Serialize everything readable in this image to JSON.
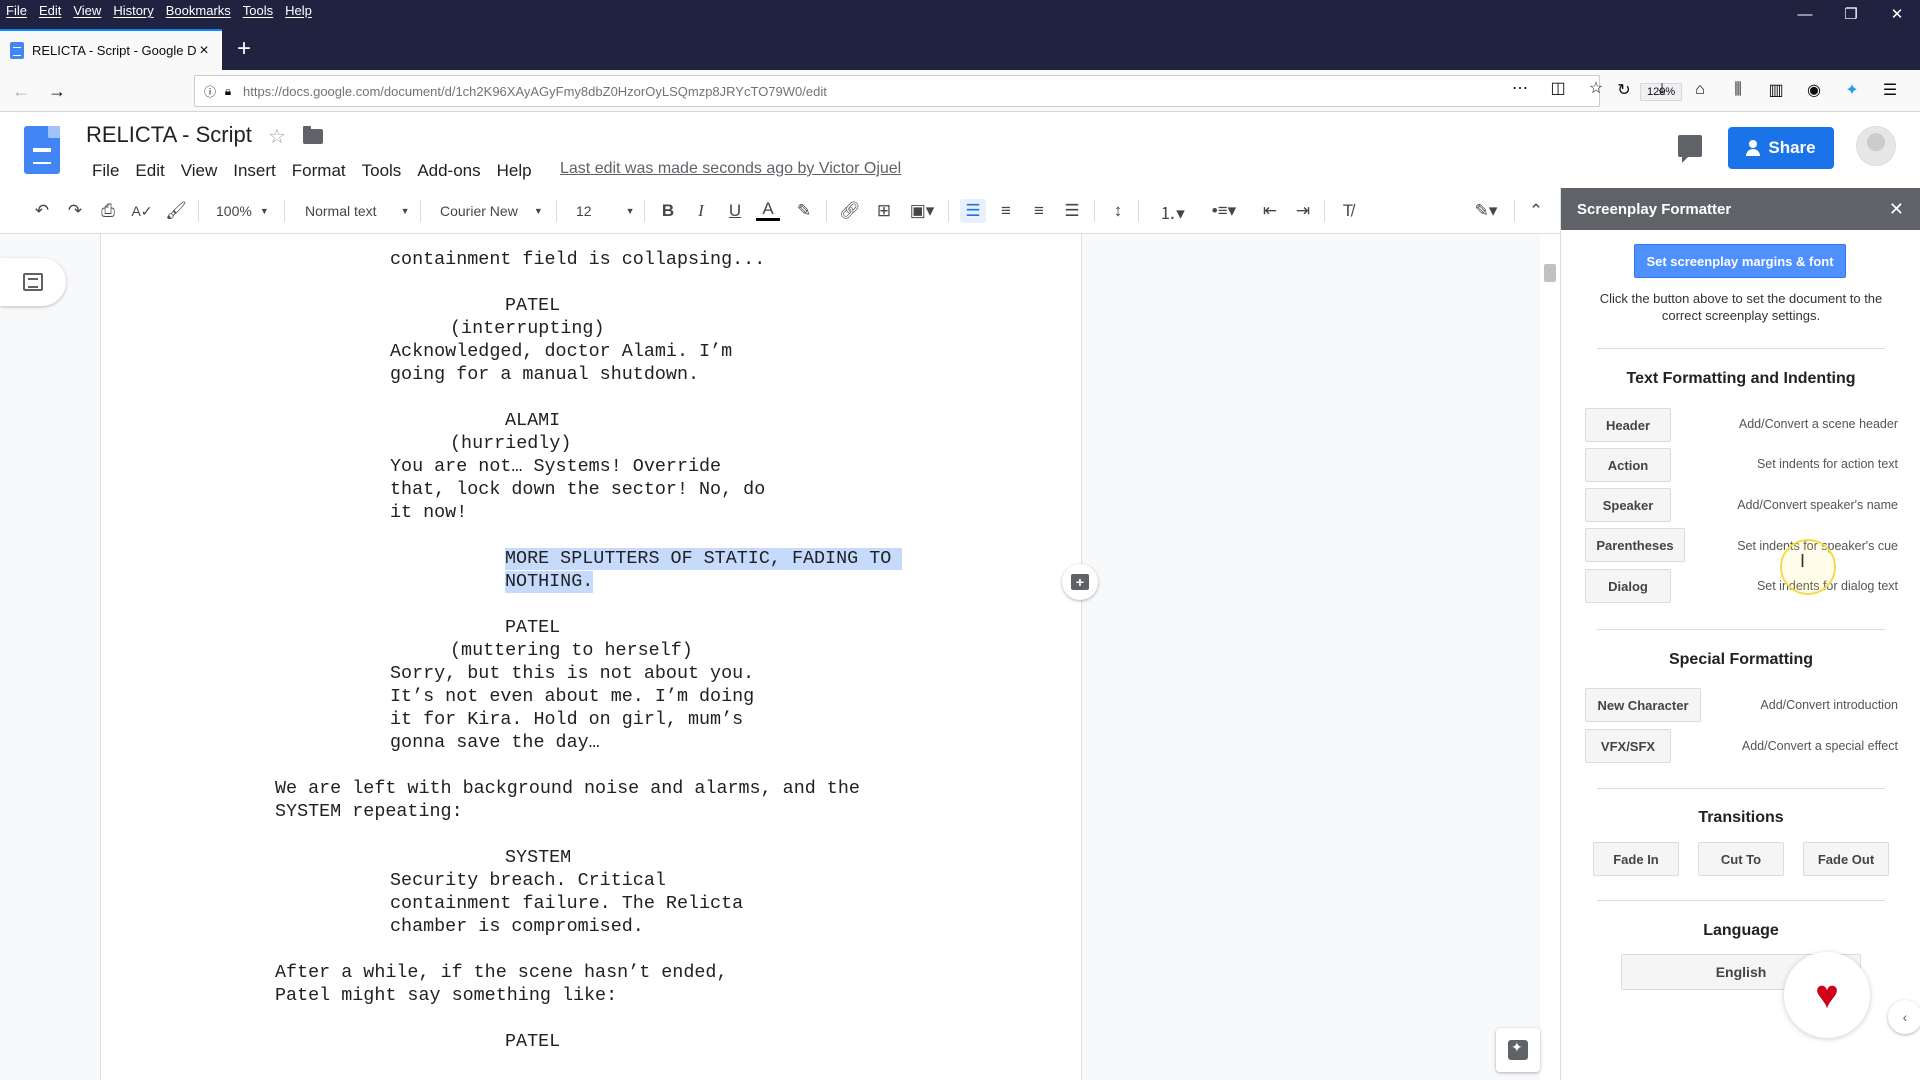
{
  "os_menu": [
    "File",
    "Edit",
    "View",
    "History",
    "Bookmarks",
    "Tools",
    "Help"
  ],
  "window_controls": {
    "minimize": "—",
    "restore": "❐",
    "close": "✕"
  },
  "browser": {
    "tab_title": "RELICTA - Script - Google Doc",
    "tab_close": "×",
    "new_tab": "+",
    "url": "https://docs.google.com/document/d/1ch2K96XAyAGyFmy8dbZ0HzorOyLSQmzp8JRYcTO79W0/edit",
    "zoom": "120%"
  },
  "docs": {
    "title": "RELICTA - Script",
    "menu": [
      "File",
      "Edit",
      "View",
      "Insert",
      "Format",
      "Tools",
      "Add-ons",
      "Help"
    ],
    "last_edit": "Last edit was made seconds ago by Victor Ojuel",
    "share_label": "Share"
  },
  "toolbar": {
    "zoom": "100%",
    "style": "Normal text",
    "font": "Courier New",
    "size": "12"
  },
  "script_lines": [
    {
      "text": "containment field is collapsing...",
      "indent": "dialog"
    },
    {
      "text": "PATEL",
      "indent": "speaker"
    },
    {
      "text": "(interrupting)",
      "indent": "paren"
    },
    {
      "text": "Acknowledged, doctor Alami. I’m",
      "indent": "dialog"
    },
    {
      "text": "going for a manual shutdown.",
      "indent": "dialog"
    },
    {
      "text": "ALAMI",
      "indent": "speaker"
    },
    {
      "text": "(hurriedly)",
      "indent": "paren"
    },
    {
      "text": "You are not… Systems! Override",
      "indent": "dialog"
    },
    {
      "text": "that, lock down the sector! No, do",
      "indent": "dialog"
    },
    {
      "text": "it now!",
      "indent": "dialog"
    },
    {
      "text": "MORE SPLUTTERS OF STATIC, FADING TO ",
      "indent": "speaker",
      "highlight": true
    },
    {
      "text": "NOTHING.",
      "indent": "speaker",
      "highlight": true
    },
    {
      "text": "PATEL",
      "indent": "speaker"
    },
    {
      "text": "(muttering to herself)",
      "indent": "paren"
    },
    {
      "text": "Sorry, but this is not about you.",
      "indent": "dialog"
    },
    {
      "text": "It’s not even about me. I’m doing",
      "indent": "dialog"
    },
    {
      "text": "it for Kira. Hold on girl, mum’s",
      "indent": "dialog"
    },
    {
      "text": "gonna save the day…",
      "indent": "dialog"
    },
    {
      "text": "We are left with background noise and alarms, and the",
      "indent": "action"
    },
    {
      "text": "SYSTEM repeating:",
      "indent": "action"
    },
    {
      "text": "SYSTEM",
      "indent": "speaker"
    },
    {
      "text": "Security breach. Critical",
      "indent": "dialog"
    },
    {
      "text": "containment failure. The Relicta",
      "indent": "dialog"
    },
    {
      "text": "chamber is compromised.",
      "indent": "dialog"
    },
    {
      "text": "After a while, if the scene hasn’t ended,",
      "indent": "action"
    },
    {
      "text": "Patel might say something like:",
      "indent": "action"
    },
    {
      "text": "PATEL",
      "indent": "speaker"
    }
  ],
  "sidebar": {
    "title": "Screenplay Formatter",
    "close": "✕",
    "primary_button": "Set screenplay margins & font",
    "description": "Click the button above to set the document to the correct screenplay settings.",
    "sections": {
      "text_formatting": "Text Formatting and Indenting",
      "special": "Special Formatting",
      "transitions": "Transitions",
      "language": "Language"
    },
    "format_buttons": [
      {
        "label": "Header",
        "desc": "Add/Convert a scene header"
      },
      {
        "label": "Action",
        "desc": "Set indents for action text"
      },
      {
        "label": "Speaker",
        "desc": "Add/Convert speaker's name"
      },
      {
        "label": "Parentheses",
        "desc": "Set indents for speaker's cue"
      },
      {
        "label": "Dialog",
        "desc": "Set indents for dialog text"
      }
    ],
    "special_buttons": [
      {
        "label": "New Character",
        "desc": "Add/Convert introduction"
      },
      {
        "label": "VFX/SFX",
        "desc": "Add/Convert a special effect"
      }
    ],
    "transition_buttons": [
      "Fade In",
      "Cut To",
      "Fade Out"
    ],
    "language_value": "English"
  }
}
